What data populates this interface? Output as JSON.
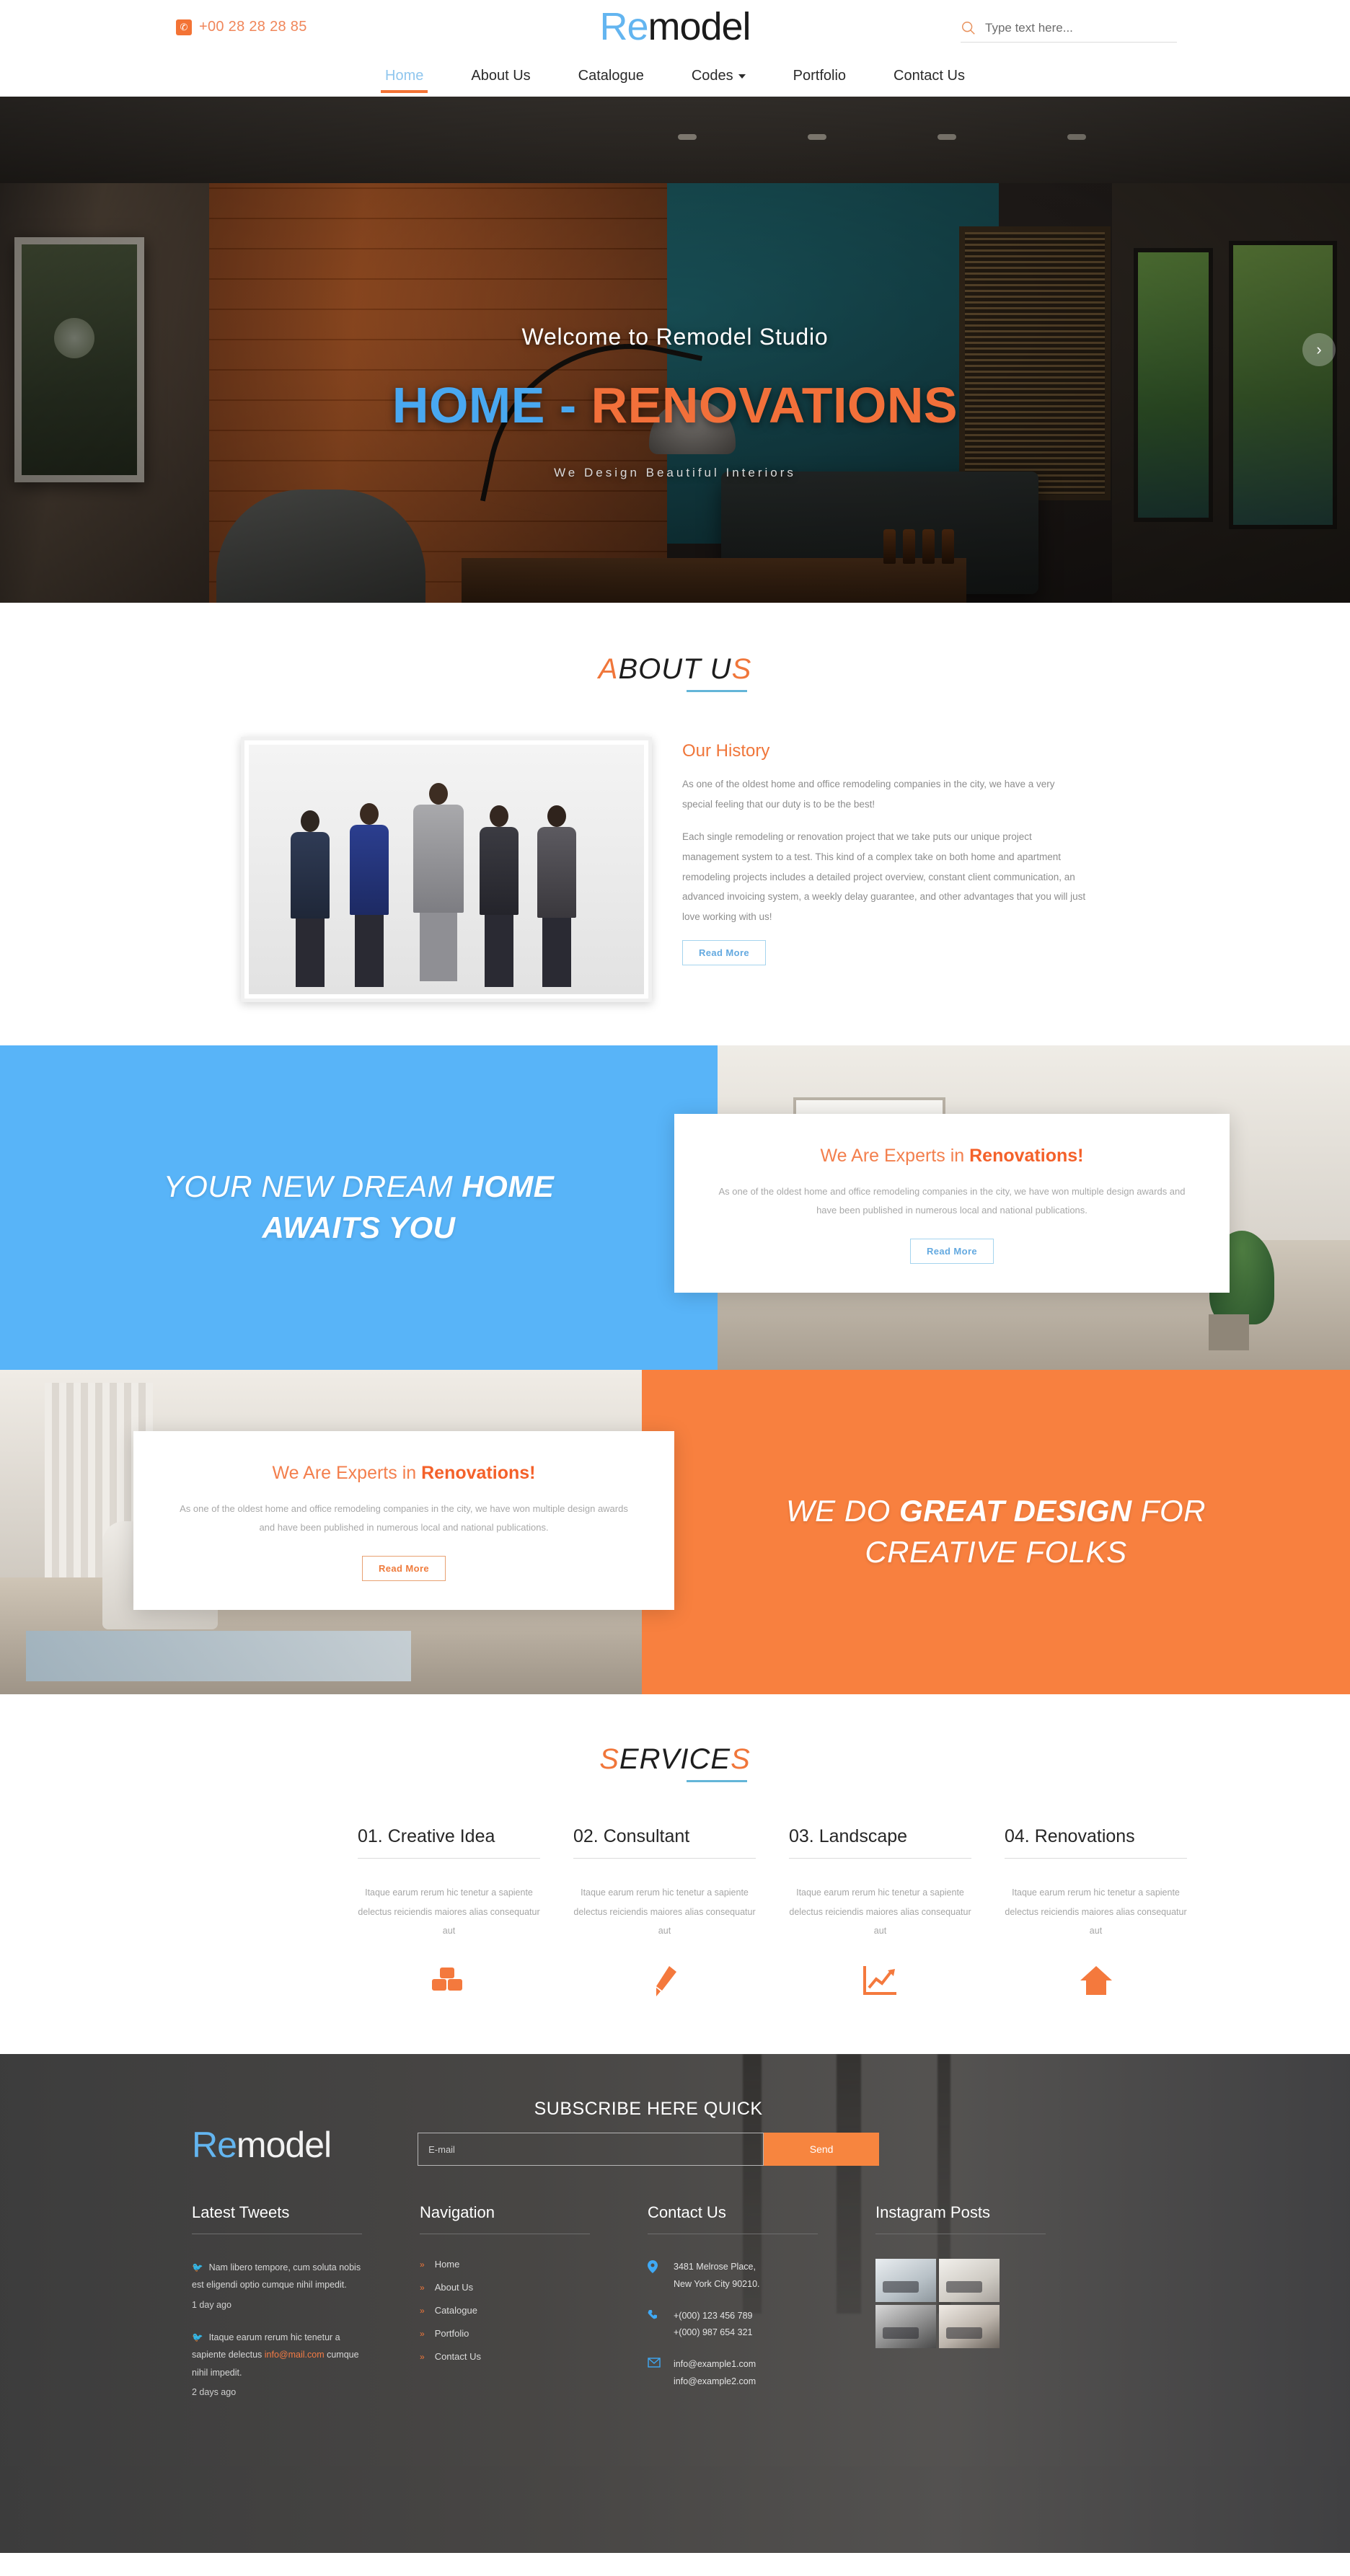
{
  "topbar": {
    "phone": "+00 28 28 28 85",
    "phone_icon": "phone-icon",
    "logo_re": "Re",
    "logo_model": "model",
    "search_placeholder": "Type text here...",
    "search_icon": "search-icon"
  },
  "nav": {
    "items": [
      {
        "label": "Home",
        "active": true
      },
      {
        "label": "About Us",
        "active": false
      },
      {
        "label": "Catalogue",
        "active": false
      },
      {
        "label": "Codes",
        "active": false,
        "has_caret": true
      },
      {
        "label": "Portfolio",
        "active": false
      },
      {
        "label": "Contact Us",
        "active": false
      }
    ]
  },
  "hero": {
    "welcome": "Welcome to Remodel Studio",
    "title_blue": "HOME",
    "title_dash": " - ",
    "title_orange": "RENOVATIONS",
    "subtitle": "We Design Beautiful Interiors",
    "next_arrow": "›"
  },
  "about": {
    "section_title_a": "A",
    "section_title_mid": "BOUT U",
    "section_title_s": "S",
    "heading": "Our History",
    "paragraph1": "As one of the oldest home and office remodeling companies in the city, we have a very special feeling that our duty is to be the best!",
    "paragraph2": "Each single remodeling or renovation project that we take puts our unique project management system to a test. This kind of a complex take on both home and apartment remodeling projects includes a detailed project overview, constant client communication, an advanced invoicing system, a weekly delay guarantee, and other advantages that you will just love working with us!",
    "button": "Read More"
  },
  "promo_blue": {
    "slogan_line1_normal": "YOUR NEW DREAM ",
    "slogan_line1_bold": "HOME",
    "slogan_line2": "AWAITS YOU",
    "card": {
      "title_normal": "We Are Experts in ",
      "title_bold": "Renovations!",
      "text": "As one of the oldest home and office remodeling companies in the city, we have won multiple design awards and have been published in numerous local and national publications.",
      "button": "Read More"
    }
  },
  "promo_orange": {
    "slogan_part1": "WE DO ",
    "slogan_bold": "GREAT DESIGN",
    "slogan_part2": " FOR",
    "slogan_line2": "CREATIVE FOLKS",
    "card": {
      "title_normal": "We Are Experts in ",
      "title_bold": "Renovations!",
      "text": "As one of the oldest home and office remodeling companies in the city, we have won multiple design awards and have been published in numerous local and national publications.",
      "button": "Read More"
    }
  },
  "services": {
    "section_title_s1": "S",
    "section_title_mid": "ERVICE",
    "section_title_s2": "S",
    "items": [
      {
        "title": "01. Creative Idea",
        "text": "Itaque earum rerum hic tenetur a sapiente delectus reiciendis maiores alias consequatur aut",
        "icon": "blocks-icon"
      },
      {
        "title": "02. Consultant",
        "text": "Itaque earum rerum hic tenetur a sapiente delectus reiciendis maiores alias consequatur aut",
        "icon": "paintbrush-icon"
      },
      {
        "title": "03. Landscape",
        "text": "Itaque earum rerum hic tenetur a sapiente delectus reiciendis maiores alias consequatur aut",
        "icon": "chart-growth-icon"
      },
      {
        "title": "04. Renovations",
        "text": "Itaque earum rerum hic tenetur a sapiente delectus reiciendis maiores alias consequatur aut",
        "icon": "home-icon"
      }
    ]
  },
  "footer": {
    "logo_re": "Re",
    "logo_model": "model",
    "subscribe_title": "SUBSCRIBE HERE QUICK",
    "email_placeholder": "E-mail",
    "send_button": "Send",
    "tweets": {
      "heading": "Latest Tweets",
      "items": [
        {
          "text": "Nam libero tempore, cum soluta nobis est eligendi optio cumque nihil impedit.",
          "link": "",
          "text_after": "",
          "time": "1 day ago"
        },
        {
          "text": "Itaque earum rerum hic tenetur a sapiente delectus ",
          "link": "info@mail.com",
          "text_after": " cumque nihil impedit.",
          "time": "2 days ago"
        }
      ]
    },
    "navigation": {
      "heading": "Navigation",
      "items": [
        "Home",
        "About Us",
        "Catalogue",
        "Portfolio",
        "Contact Us"
      ]
    },
    "contact": {
      "heading": "Contact Us",
      "address_line1": "3481 Melrose Place,",
      "address_line2": "New York City 90210.",
      "phone1": "+(000) 123 456 789",
      "phone2": "+(000) 987 654 321",
      "email1": "info@example1.com",
      "email2": "info@example2.com"
    },
    "instagram": {
      "heading": "Instagram Posts",
      "count": 4
    }
  },
  "colors": {
    "orange": "#f37335",
    "blue": "#58b4f8",
    "logo_blue": "#63b5f0",
    "hero_blue": "#49a8f0",
    "hero_orange": "#f2703a",
    "footer_bg": "#4a4a4a"
  }
}
